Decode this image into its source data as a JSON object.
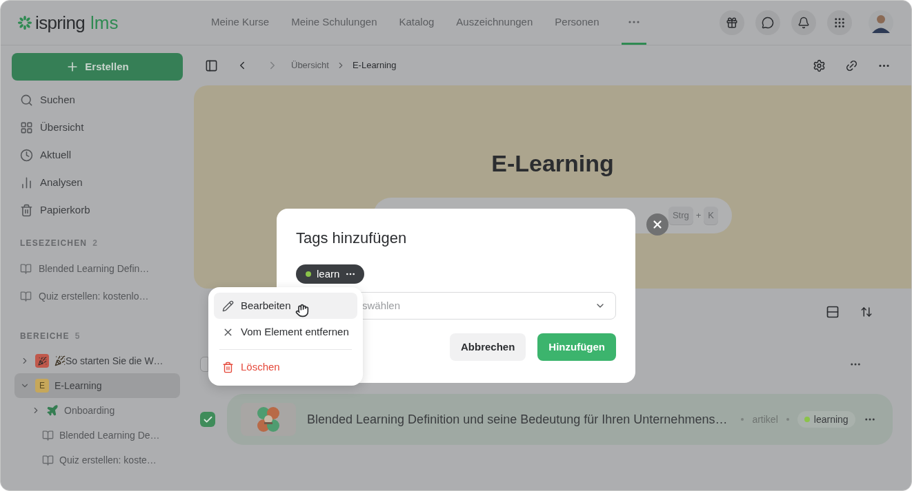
{
  "logo": {
    "word": "ispring",
    "accent": "lms"
  },
  "nav": [
    {
      "label": "Meine Kurse",
      "selected": false
    },
    {
      "label": "Meine Schulungen",
      "selected": false
    },
    {
      "label": "Katalog",
      "selected": false
    },
    {
      "label": "Auszeichnungen",
      "selected": false
    },
    {
      "label": "Personen",
      "selected": false
    }
  ],
  "nav_more": {
    "selected": true
  },
  "create_button": "Erstellen",
  "sidebar": {
    "items": [
      {
        "label": "Suchen",
        "kind": "search"
      },
      {
        "label": "Übersicht",
        "kind": "grid"
      },
      {
        "label": "Aktuell",
        "kind": "clock"
      },
      {
        "label": "Analysen",
        "kind": "chart"
      },
      {
        "label": "Papierkorb",
        "kind": "trash"
      }
    ],
    "bookmarks": {
      "title": "LESEZEICHEN",
      "count": "2",
      "items": [
        {
          "label": "Blended Learning Defin…"
        },
        {
          "label": "Quiz erstellen: kostenlo…"
        }
      ]
    },
    "areas": {
      "title": "BEREICHE",
      "count": "5",
      "items": [
        {
          "kind": "emoji",
          "label": "So starten Sie die W…",
          "expanded": false,
          "selected": false,
          "color": "#c0584b"
        },
        {
          "kind": "letter",
          "letter": "E",
          "label": "E-Learning",
          "expanded": true,
          "selected": true,
          "color": "#c6a75a",
          "children": [
            {
              "kind": "folder",
              "label": "Onboarding",
              "expanded": false
            },
            {
              "kind": "page",
              "label": "Blended Learning De…"
            },
            {
              "kind": "page",
              "label": "Quiz erstellen: koste…"
            }
          ]
        }
      ]
    }
  },
  "breadcrumb": [
    "Übersicht",
    "E-Learning"
  ],
  "banner": {
    "title": "E-Learning",
    "shortcut": {
      "keys": [
        "Strg",
        "K"
      ],
      "joiner": "+"
    }
  },
  "rows": [
    {
      "kind": "item",
      "checked": false
    },
    {
      "kind": "item",
      "checked": true,
      "title": "Blended Learning Definition und seine Bedeutung für Ihren Unternehmens…",
      "type": "artikel",
      "tag": {
        "label": "learning",
        "color": "#8bc34a"
      }
    }
  ],
  "dialog": {
    "title": "Tags hinzufügen",
    "chip": {
      "label": "learn",
      "color": "#8bc34a"
    },
    "select": {
      "placeholder": "swählen"
    },
    "buttons": [
      {
        "label": "Abbrechen",
        "kind": "secondary"
      },
      {
        "label": "Hinzufügen",
        "kind": "primary"
      }
    ]
  },
  "menu": {
    "items": [
      {
        "label": "Bearbeiten",
        "kind": "edit",
        "selected": true
      },
      {
        "label": "Vom Element entfernen",
        "kind": "remove",
        "selected": false
      },
      {
        "label": "Löschen",
        "kind": "delete",
        "selected": false
      }
    ]
  }
}
